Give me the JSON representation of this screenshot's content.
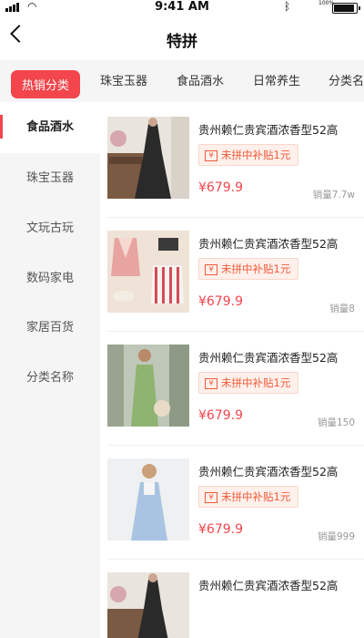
{
  "status": {
    "time": "9:41 AM",
    "battery_percent": "100%"
  },
  "nav": {
    "title": "特拼"
  },
  "tabs": [
    "热销分类",
    "珠宝玉器",
    "食品酒水",
    "日常养生",
    "分类名称"
  ],
  "sidebar": [
    "食品酒水",
    "珠宝玉器",
    "文玩古玩",
    "数码家电",
    "家居百货",
    "分类名称"
  ],
  "products": [
    {
      "name": "贵州赖仁贵宾酒浓香型52高",
      "subsidy": "未拼中补贴1元",
      "price": "¥679.9",
      "sales": "销量7.7w"
    },
    {
      "name": "贵州赖仁贵宾酒浓香型52高",
      "subsidy": "未拼中补贴1元",
      "price": "¥679.9",
      "sales": "销量8"
    },
    {
      "name": "贵州赖仁贵宾酒浓香型52高",
      "subsidy": "未拼中补贴1元",
      "price": "¥679.9",
      "sales": "销量150"
    },
    {
      "name": "贵州赖仁贵宾酒浓香型52高",
      "subsidy": "未拼中补贴1元",
      "price": "¥679.9",
      "sales": "销量999"
    },
    {
      "name": "贵州赖仁贵宾酒浓香型52高",
      "subsidy": "",
      "price": "",
      "sales": ""
    }
  ],
  "colors": {
    "accent": "#f2464c",
    "subsidy_text": "#f05a3a",
    "subsidy_bg": "#fff0eb",
    "sidebar_bg": "#f5f5f5"
  }
}
